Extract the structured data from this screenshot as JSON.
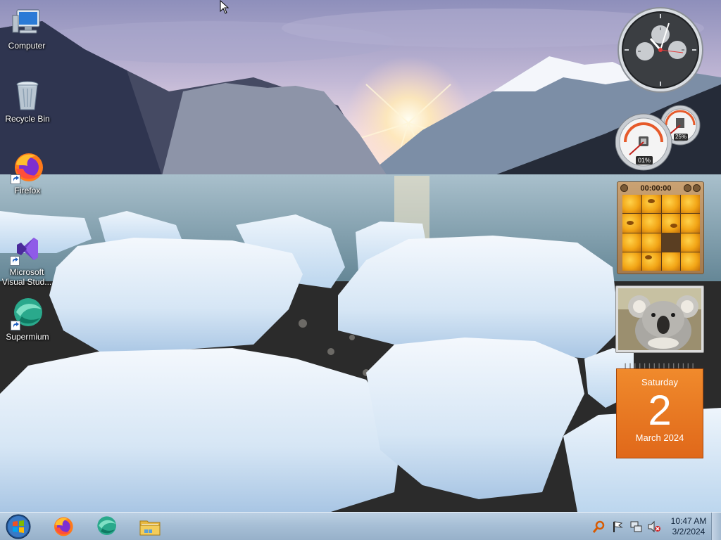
{
  "desktop": {
    "icons": [
      {
        "label": "Computer",
        "icon": "computer-icon"
      },
      {
        "label": "Recycle Bin",
        "icon": "recycle-bin-icon"
      },
      {
        "label": "Firefox",
        "icon": "firefox-icon"
      },
      {
        "label": "Microsoft Visual Stud...",
        "label_line1": "Microsoft",
        "label_line2": "Visual Stud...",
        "icon": "visual-studio-icon"
      },
      {
        "label": "Supermium",
        "icon": "supermium-icon"
      }
    ]
  },
  "gadgets": {
    "cpu_meter": {
      "cpu": "01%",
      "memory": "25%"
    },
    "puzzle": {
      "timer": "00:00:00"
    },
    "calendar": {
      "weekday": "Saturday",
      "day": "2",
      "month_year": "March 2024"
    }
  },
  "taskbar": {
    "pinned": [
      {
        "name": "Firefox",
        "icon": "firefox-icon"
      },
      {
        "name": "Supermium",
        "icon": "supermium-icon"
      },
      {
        "name": "Windows Explorer",
        "icon": "folder-icon"
      }
    ],
    "tray": {
      "time": "10:47 AM",
      "date": "3/2/2024"
    }
  },
  "colors": {
    "taskbar": "#a7bfd6",
    "calendar": "#e97a22",
    "puzzle_frame": "#b38a5c"
  }
}
